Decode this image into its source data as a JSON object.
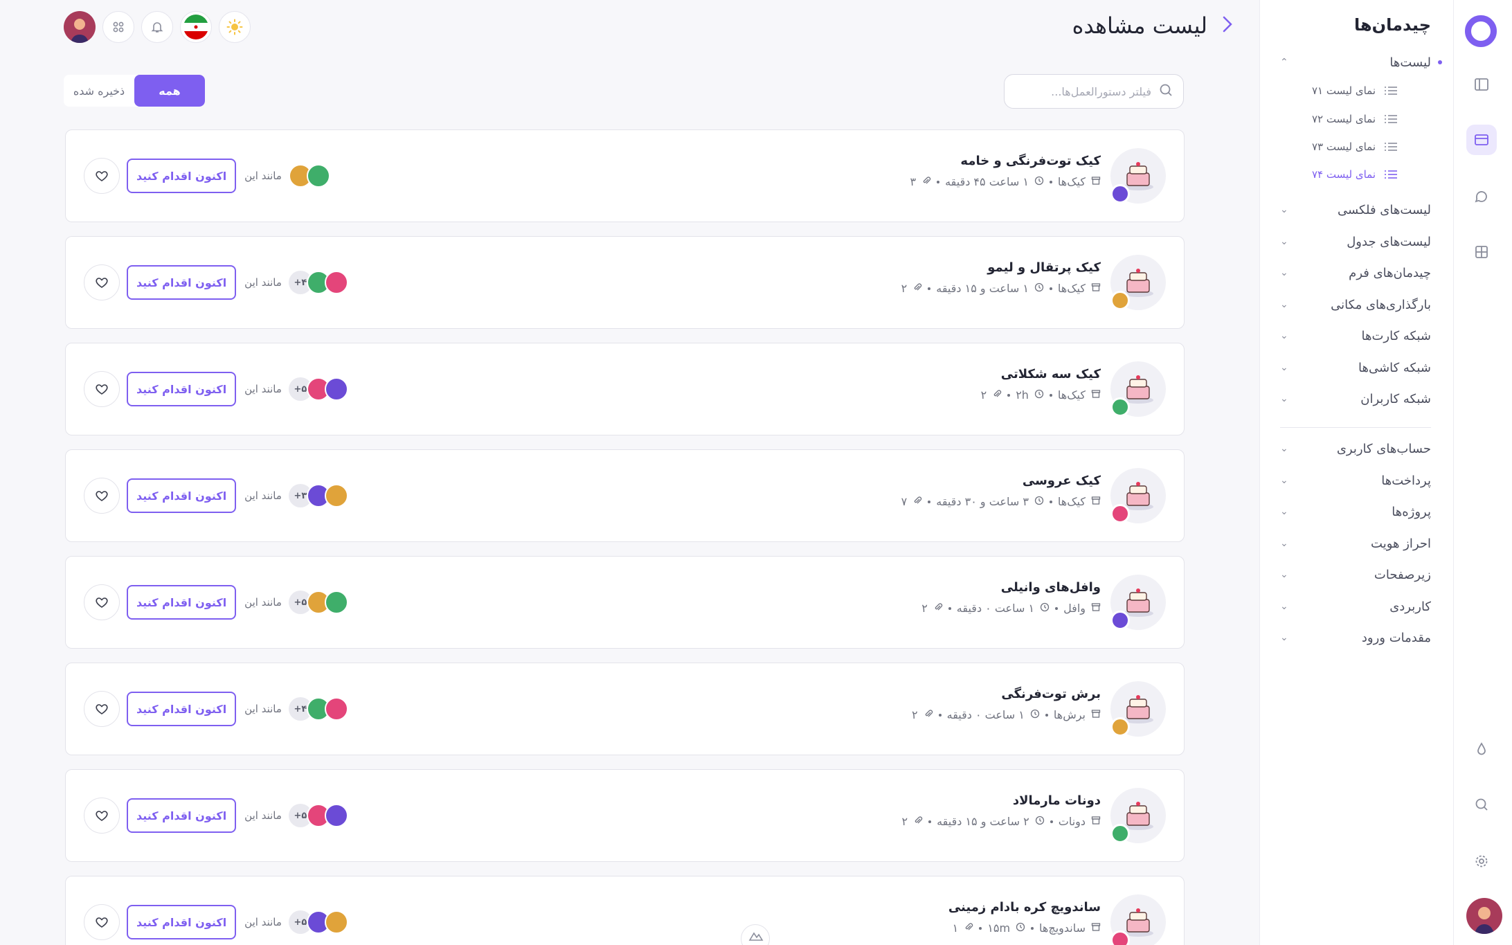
{
  "header": {
    "title": "لیست مشاهده"
  },
  "search": {
    "placeholder": "فیلتر دستورالعمل‌ها..."
  },
  "segments": {
    "all": "همه",
    "saved": "ذخیره شده"
  },
  "sidebar": {
    "title": "چیدمان‌ها",
    "lists_label": "لیست‌ها",
    "sub_items": [
      "نمای لیست ۷۱",
      "نمای لیست ۷۲",
      "نمای لیست ۷۳",
      "نمای لیست ۷۴"
    ],
    "groups": [
      "لیست‌های فلکسی",
      "لیست‌های جدول",
      "چیدمان‌های فرم",
      "بارگذاری‌های مکانی",
      "شبکه کارت‌ها",
      "شبکه کاشی‌ها",
      "شبکه کاربران"
    ],
    "sections": [
      "حساب‌های کاربری",
      "پرداخت‌ها",
      "پروژه‌ها",
      "احراز هویت",
      "زیرصفحات",
      "کاربردی",
      "مقدمات ورود"
    ]
  },
  "cta_label": "اکنون اقدام کنید",
  "like_label": "مانند این",
  "recipes": [
    {
      "name": "کیک توت‌فرنگی و خامه",
      "category": "کیک‌ها",
      "time": "۱ ساعت ۴۵ دقیقه",
      "attachments": "۳",
      "extra": ""
    },
    {
      "name": "کیک پرتقال و لیمو",
      "category": "کیک‌ها",
      "time": "۱ ساعت و ۱۵ دقیقه",
      "attachments": "۲",
      "extra": "+۴"
    },
    {
      "name": "کیک سه شکلاتی",
      "category": "کیک‌ها",
      "time": "۲h",
      "attachments": "۲",
      "extra": "+۵"
    },
    {
      "name": "کیک عروسی",
      "category": "کیک‌ها",
      "time": "۳ ساعت و ۳۰ دقیقه",
      "attachments": "۷",
      "extra": "+۳"
    },
    {
      "name": "وافل‌های وانیلی",
      "category": "وافل",
      "time": "۱ ساعت ۰ دقیقه",
      "attachments": "۲",
      "extra": "+۵"
    },
    {
      "name": "برش توت‌فرنگی",
      "category": "برش‌ها",
      "time": "۱ ساعت ۰ دقیقه",
      "attachments": "۲",
      "extra": "+۴"
    },
    {
      "name": "دونات مارمالاد",
      "category": "دونات",
      "time": "۲ ساعت و ۱۵ دقیقه",
      "attachments": "۲",
      "extra": "+۵"
    },
    {
      "name": "ساندویچ کره بادام زمینی",
      "category": "ساندویچ‌ها",
      "time": "۱۵m",
      "attachments": "۱",
      "extra": "+۵"
    }
  ],
  "colors": {
    "accent": "#7e5ff0",
    "avatar1": "#e0a33a",
    "avatar2": "#3fae6a",
    "avatar3": "#e4457a",
    "avatar4": "#6b4bd6"
  }
}
